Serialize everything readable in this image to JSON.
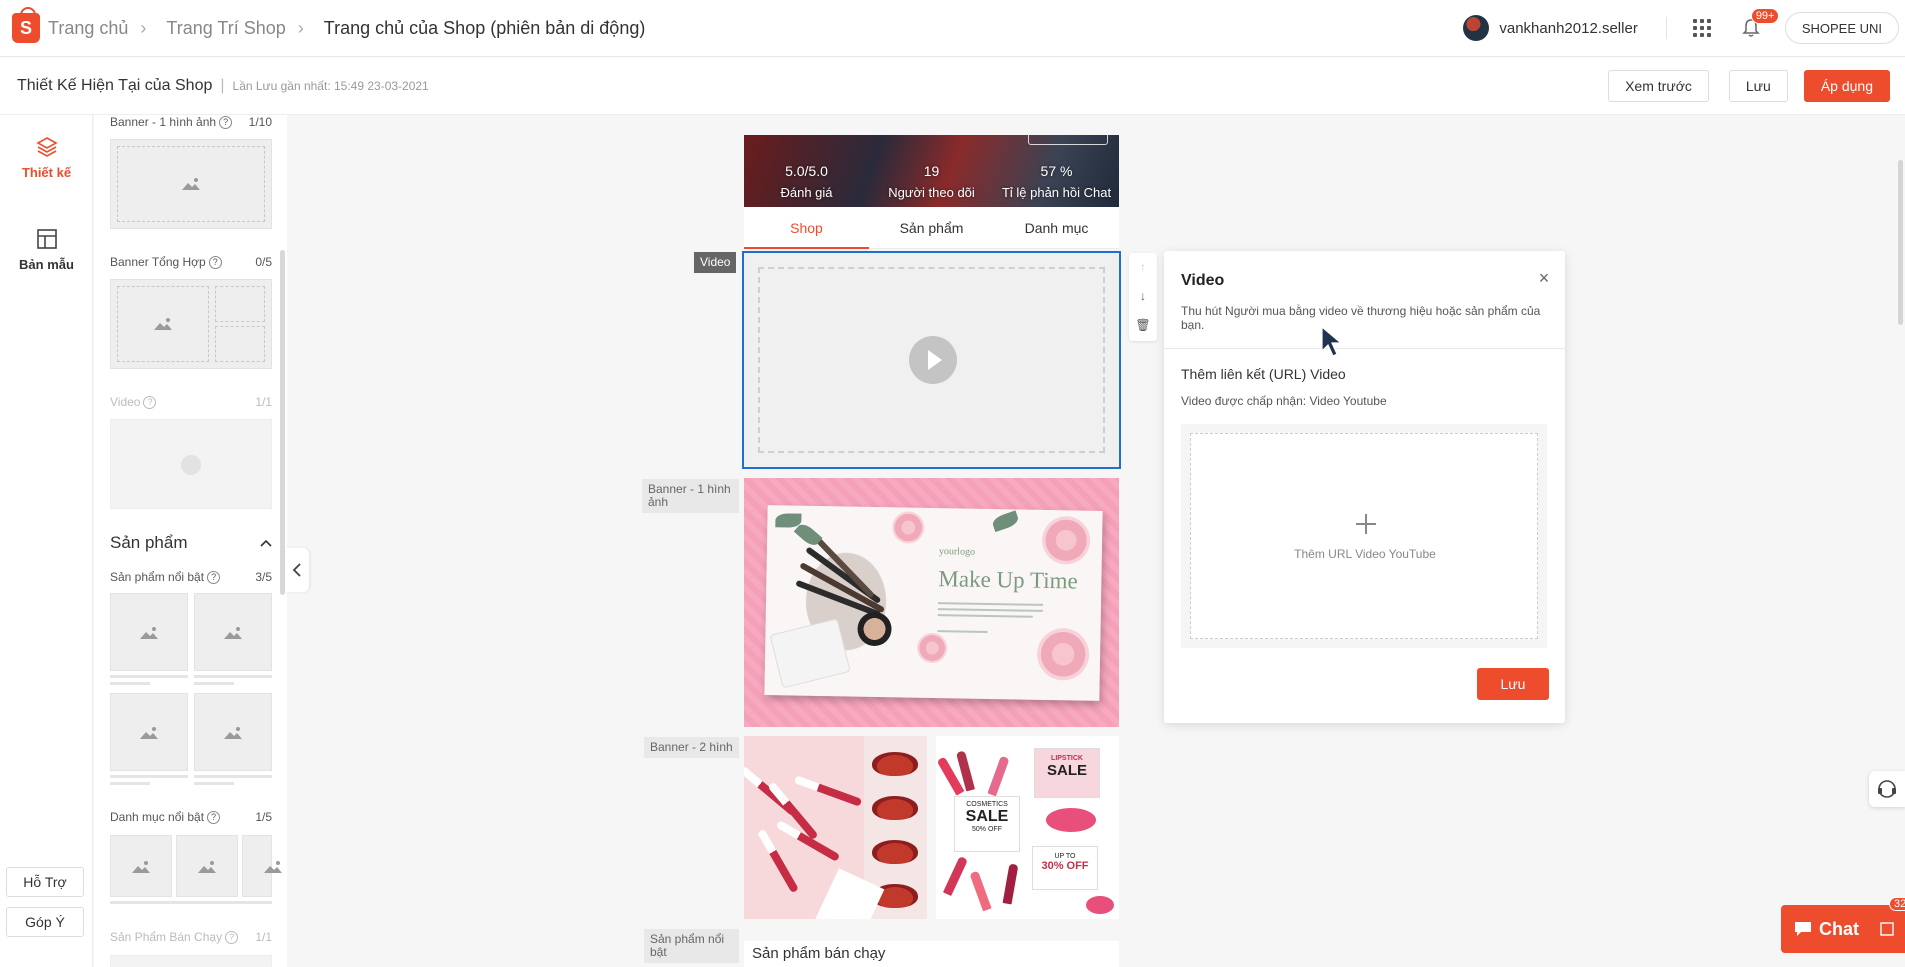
{
  "nav": {
    "breadcrumbs": [
      "Trang chủ",
      "Trang Trí Shop",
      "Trang chủ của Shop (phiên bản di động)"
    ],
    "username": "vankhanh2012.seller",
    "notif_count": "99+",
    "uni_label": "SHOPEE UNI"
  },
  "subheader": {
    "title": "Thiết Kế Hiện Tại của Shop",
    "last_saved": "Lần Lưu gần nhất: 15:49 23-03-2021",
    "preview_label": "Xem trước",
    "save_label": "Lưu",
    "apply_label": "Áp dụng"
  },
  "rail": {
    "design_label": "Thiết kế",
    "templates_label": "Bản mẫu",
    "support_label": "Hỗ Trợ",
    "feedback_label": "Góp Ý"
  },
  "panel": {
    "banner1": {
      "label": "Banner - 1 hình ảnh",
      "count": "1/10"
    },
    "banner_mix": {
      "label": "Banner Tổng Hợp",
      "count": "0/5"
    },
    "video": {
      "label": "Video",
      "count": "1/1"
    },
    "products_section": "Sản phẩm",
    "featured_products": {
      "label": "Sản phẩm nổi bật",
      "count": "3/5"
    },
    "featured_categories": {
      "label": "Danh mục nổi bật",
      "count": "1/5"
    },
    "best_sellers": {
      "label": "Sản Phẩm Bán Chạy",
      "count": "1/1"
    }
  },
  "preview": {
    "stats": [
      {
        "value": "5.0/5.0",
        "label": "Đánh giá"
      },
      {
        "value": "19",
        "label": "Người theo dõi"
      },
      {
        "value": "57 %",
        "label": "Tỉ lệ phản hồi Chat"
      }
    ],
    "tabs": [
      "Shop",
      "Sản phẩm",
      "Danh mục"
    ],
    "labels": {
      "video": "Video",
      "banner1": "Banner - 1 hình ảnh",
      "banner2": "Banner - 2 hình",
      "best": "Sản phẩm nổi bật"
    },
    "banner_logo": "yourlogo",
    "banner_title": "Make Up Time",
    "best_sellers_title": "Sản phẩm bán chạy",
    "sale1": "SALE",
    "sale1_sub": "COSMETICS",
    "sale1_pct": "50% OFF",
    "sale2": "SALE",
    "sale2_sub": "LIPSTICK",
    "sale3": "30% OFF",
    "sale3_sub": "UP TO"
  },
  "video_popup": {
    "title": "Video",
    "description": "Thu hút Người mua bằng video về thương hiệu hoặc sản phẩm của bạn.",
    "url_label": "Thêm liên kết (URL) Video",
    "accepted": "Video được chấp nhận: Video Youtube",
    "add_url": "Thêm URL Video YouTube",
    "save_label": "Lưu"
  },
  "chat": {
    "label": "Chat",
    "badge": "32"
  },
  "colors": {
    "brand": "#ee4d2d",
    "selection": "#1f6fd1"
  }
}
